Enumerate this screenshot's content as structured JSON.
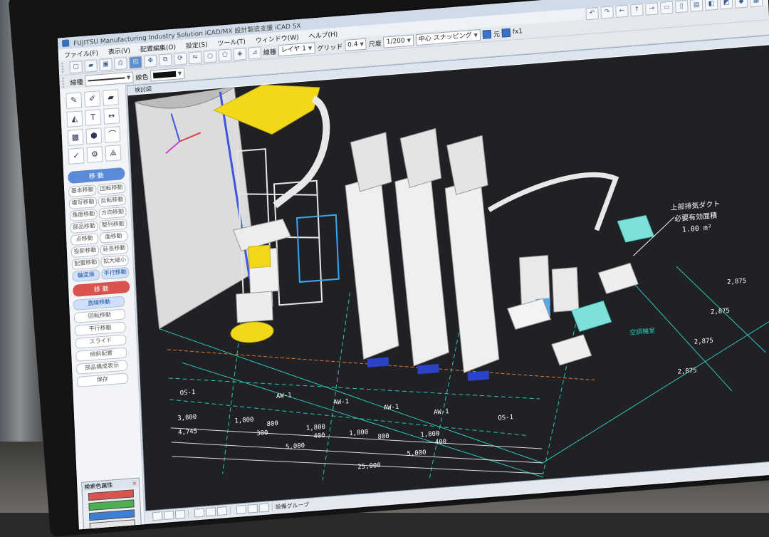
{
  "app": {
    "title": "FUJITSU Manufacturing Industry Solution iCAD/MX 設計製造支援 iCAD SX",
    "window_buttons": [
      "—",
      "□",
      "×"
    ]
  },
  "menu": {
    "items": [
      "ファイル(F)",
      "表示(V)",
      "配置編集(O)",
      "設定(S)",
      "ツール(T)",
      "ウィンドウ(W)",
      "ヘルプ(H)"
    ]
  },
  "toolbar": {
    "layer_label": "線種",
    "color_label": "線色",
    "layer_value": "レイヤ 1",
    "grid_label": "グリッド",
    "grid_value": "0.4",
    "scale_label": "尺度",
    "scale_value": "1/200",
    "snap_value": "中心 スナッピング",
    "chk1_label": "元",
    "chk2_label": "fx1"
  },
  "left_panel": {
    "section_move": "移 動",
    "section_move2": "移 動",
    "commands": [
      "基本移動",
      "回転移動",
      "複写移動",
      "反転移動",
      "角度移動",
      "方向移動",
      "部品移動",
      "整列移動",
      "点移動",
      "面移動",
      "投影移動",
      "延長移動",
      "配置移動",
      "拡大縮小",
      "軸変換",
      "平行移動"
    ],
    "commands2": [
      "直線移動",
      "回転移動",
      "平行移動",
      "スライド",
      "傾斜配置",
      "部品構成表示",
      "保存"
    ],
    "float_title": "検索色属性",
    "float_close": "×",
    "swatch_colors": [
      "#d9534f",
      "#4caf50",
      "#3e7fd6",
      "#e6e6e6"
    ]
  },
  "view": {
    "tab_label": "検討図",
    "annotations": {
      "note1": "上部排気ダクト",
      "note2": "必要有効面積",
      "note3": "1.00 m²",
      "block_label": "空調機室"
    },
    "grid_labels": [
      "OS-1",
      "AW-1",
      "AW-1",
      "AW-1",
      "AW-1",
      "OS-1"
    ],
    "dims": [
      "3,800",
      "4,745",
      "1,800",
      "800",
      "300",
      "1,800",
      "400",
      "1,800",
      "800",
      "1,800",
      "400",
      "5,000",
      "5,000",
      "25,000",
      "2,875",
      "2,875",
      "2,875",
      "2,875"
    ],
    "status_label": "設備グループ"
  }
}
